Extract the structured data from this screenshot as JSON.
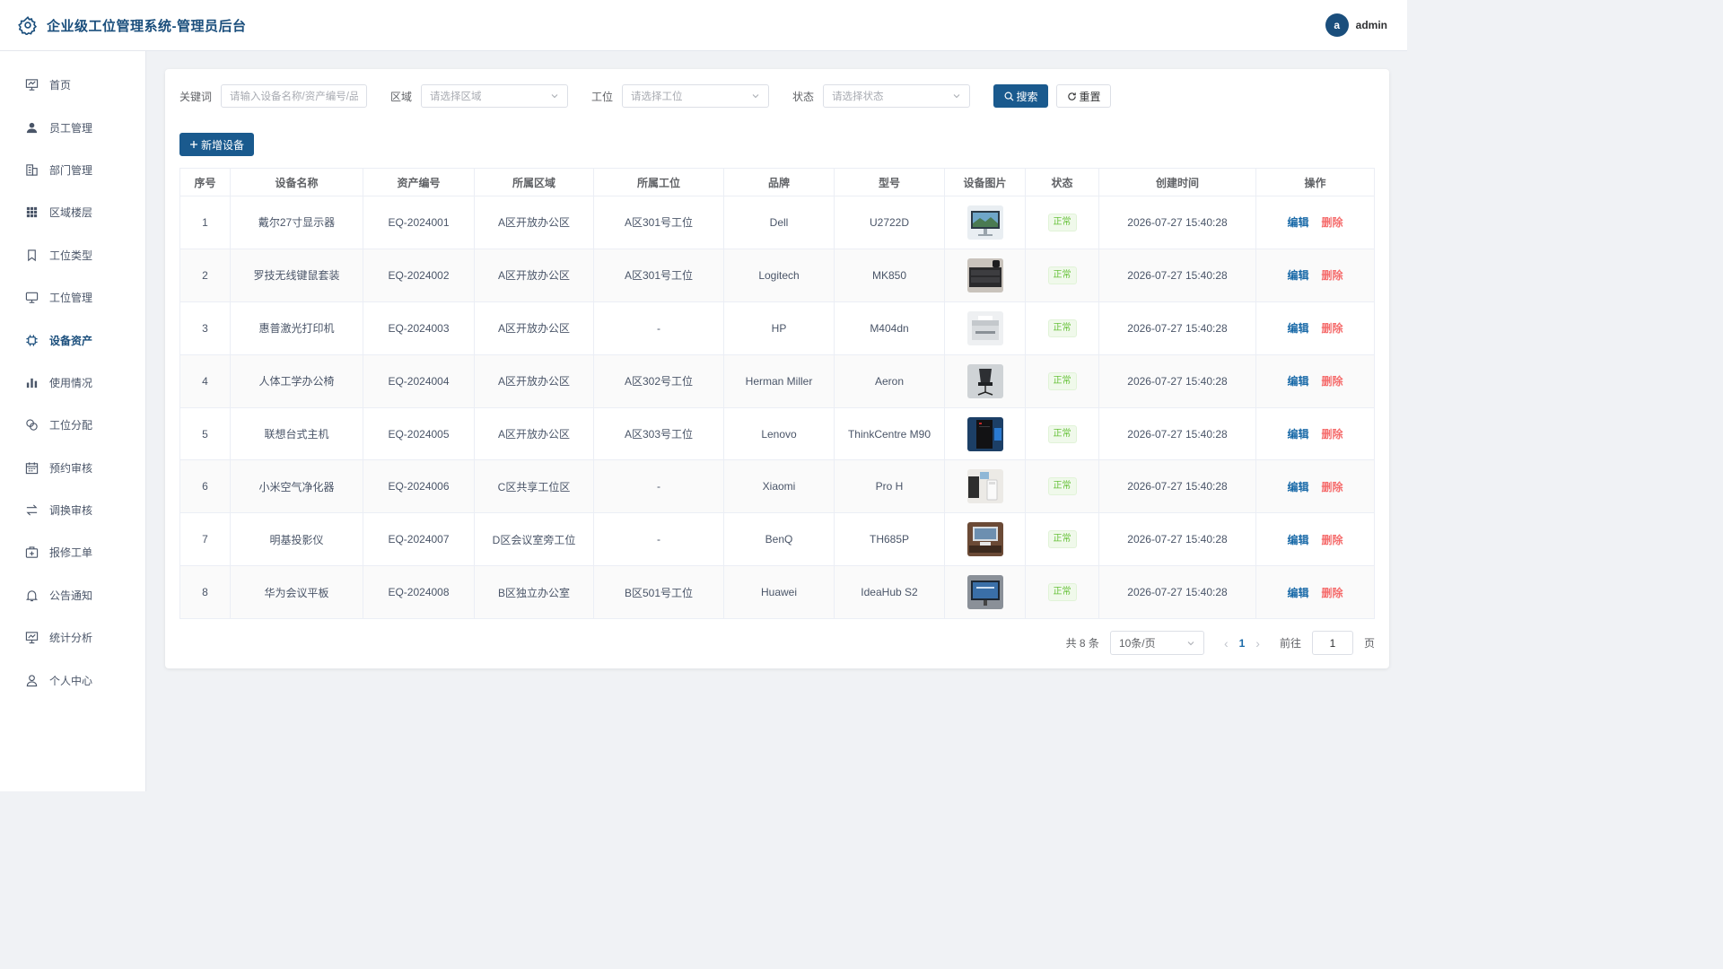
{
  "header": {
    "title": "企业级工位管理系统-管理员后台",
    "avatar_letter": "a",
    "username": "admin",
    "brand_color": "#1a4e7c"
  },
  "sidebar": {
    "items": [
      {
        "label": "首页",
        "icon": "dashboard-icon"
      },
      {
        "label": "员工管理",
        "icon": "user-icon"
      },
      {
        "label": "部门管理",
        "icon": "building-icon"
      },
      {
        "label": "区域楼层",
        "icon": "grid-icon"
      },
      {
        "label": "工位类型",
        "icon": "bookmark-icon"
      },
      {
        "label": "工位管理",
        "icon": "monitor-icon"
      },
      {
        "label": "设备资产",
        "icon": "chip-icon",
        "active": true
      },
      {
        "label": "使用情况",
        "icon": "bar-chart-icon"
      },
      {
        "label": "工位分配",
        "icon": "coins-icon"
      },
      {
        "label": "预约审核",
        "icon": "calendar-icon"
      },
      {
        "label": "调换审核",
        "icon": "swap-icon"
      },
      {
        "label": "报修工单",
        "icon": "repair-icon"
      },
      {
        "label": "公告通知",
        "icon": "bell-icon"
      },
      {
        "label": "统计分析",
        "icon": "presentation-icon"
      },
      {
        "label": "个人中心",
        "icon": "person-icon"
      }
    ]
  },
  "filters": {
    "keyword": {
      "label": "关键词",
      "placeholder": "请输入设备名称/资产编号/品..."
    },
    "area": {
      "label": "区域",
      "placeholder": "请选择区域"
    },
    "station": {
      "label": "工位",
      "placeholder": "请选择工位"
    },
    "status": {
      "label": "状态",
      "placeholder": "请选择状态"
    },
    "search_label": "搜索",
    "reset_label": "重置"
  },
  "add_label": "新增设备",
  "table": {
    "columns": [
      "序号",
      "设备名称",
      "资产编号",
      "所属区域",
      "所属工位",
      "品牌",
      "型号",
      "设备图片",
      "状态",
      "创建时间",
      "操作"
    ],
    "edit_label": "编辑",
    "delete_label": "删除",
    "rows": [
      {
        "no": "1",
        "name": "戴尔27寸显示器",
        "asset": "EQ-2024001",
        "area": "A区开放办公区",
        "station": "A区301号工位",
        "brand": "Dell",
        "model": "U2722D",
        "image": "monitor-photo",
        "status": "正常",
        "created": "2026-07-27 15:40:28"
      },
      {
        "no": "2",
        "name": "罗技无线键鼠套装",
        "asset": "EQ-2024002",
        "area": "A区开放办公区",
        "station": "A区301号工位",
        "brand": "Logitech",
        "model": "MK850",
        "image": "keyboard-photo",
        "status": "正常",
        "created": "2026-07-27 15:40:28"
      },
      {
        "no": "3",
        "name": "惠普激光打印机",
        "asset": "EQ-2024003",
        "area": "A区开放办公区",
        "station": "-",
        "brand": "HP",
        "model": "M404dn",
        "image": "printer-photo",
        "status": "正常",
        "created": "2026-07-27 15:40:28"
      },
      {
        "no": "4",
        "name": "人体工学办公椅",
        "asset": "EQ-2024004",
        "area": "A区开放办公区",
        "station": "A区302号工位",
        "brand": "Herman Miller",
        "model": "Aeron",
        "image": "chair-photo",
        "status": "正常",
        "created": "2026-07-27 15:40:28"
      },
      {
        "no": "5",
        "name": "联想台式主机",
        "asset": "EQ-2024005",
        "area": "A区开放办公区",
        "station": "A区303号工位",
        "brand": "Lenovo",
        "model": "ThinkCentre M90",
        "image": "desktop-photo",
        "status": "正常",
        "created": "2026-07-27 15:40:28"
      },
      {
        "no": "6",
        "name": "小米空气净化器",
        "asset": "EQ-2024006",
        "area": "C区共享工位区",
        "station": "-",
        "brand": "Xiaomi",
        "model": "Pro H",
        "image": "purifier-photo",
        "status": "正常",
        "created": "2026-07-27 15:40:28"
      },
      {
        "no": "7",
        "name": "明基投影仪",
        "asset": "EQ-2024007",
        "area": "D区会议室旁工位",
        "station": "-",
        "brand": "BenQ",
        "model": "TH685P",
        "image": "projector-photo",
        "status": "正常",
        "created": "2026-07-27 15:40:28"
      },
      {
        "no": "8",
        "name": "华为会议平板",
        "asset": "EQ-2024008",
        "area": "B区独立办公室",
        "station": "B区501号工位",
        "brand": "Huawei",
        "model": "IdeaHub S2",
        "image": "board-photo",
        "status": "正常",
        "created": "2026-07-27 15:40:28"
      }
    ]
  },
  "pagination": {
    "total": "共 8 条",
    "page_size": "10条/页",
    "current": "1",
    "goto_label": "前往",
    "goto_value": "1",
    "page_suffix": "页"
  }
}
